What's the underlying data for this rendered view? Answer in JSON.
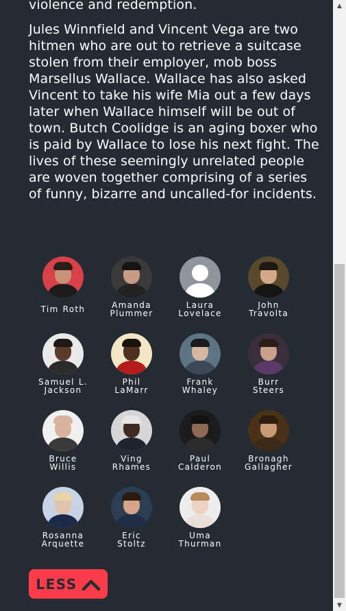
{
  "overview": {
    "tail": "violence and redemption.",
    "text": "Jules Winnfield and Vincent Vega are two hitmen who are out to retrieve a suitcase stolen from their employer, mob boss Marsellus Wallace. Wallace has also asked Vincent to take his wife Mia out a few days later when Wallace himself will be out of town. Butch Coolidge is an aging boxer who is paid by Wallace to lose his next fight. The lives of these seemingly unrelated people are woven together comprising of a series of funny, bizarre and uncalled-for incidents."
  },
  "cast": [
    {
      "first": "Tim Roth",
      "last": "",
      "skin": "#c99178",
      "bg": "#d8404a",
      "hair": "#2a1e18",
      "shirt": "#1b1b1b"
    },
    {
      "first": "Amanda",
      "last": "Plummer",
      "skin": "#c79c84",
      "bg": "#3a3a3a",
      "hair": "#141414",
      "shirt": "#222222"
    },
    {
      "first": "Laura",
      "last": "Lovelace",
      "skin": "",
      "bg": "",
      "hair": "",
      "shirt": "",
      "placeholder": true
    },
    {
      "first": "John",
      "last": "Travolta",
      "skin": "#d4a88a",
      "bg": "#5a4a2c",
      "hair": "#1e1812",
      "shirt": "#141414"
    },
    {
      "first": "Samuel L.",
      "last": "Jackson",
      "skin": "#5b3b2a",
      "bg": "#e9e9e9",
      "hair": "#1f1a18",
      "shirt": "#2b2b2b"
    },
    {
      "first": "Phil",
      "last": "LaMarr",
      "skin": "#4e2f20",
      "bg": "#f2e6c6",
      "hair": "#1a120c",
      "shirt": "#b41c1c"
    },
    {
      "first": "Frank",
      "last": "Whaley",
      "skin": "#d8b7a2",
      "bg": "#5e7384",
      "hair": "#1b1b1b",
      "shirt": "#3c4856"
    },
    {
      "first": "Burr",
      "last": "Steers",
      "skin": "#c9a08c",
      "bg": "#3a2e3a",
      "hair": "#2a1d18",
      "shirt": "#5b3a6a"
    },
    {
      "first": "Bruce",
      "last": "Willis",
      "skin": "#d9b29d",
      "bg": "#f0f0f0",
      "hair": "#d9b29d",
      "shirt": "#3a3a3a"
    },
    {
      "first": "Ving",
      "last": "Rhames",
      "skin": "#3e2a20",
      "bg": "#d6d6d6",
      "hair": "#e6e6e6",
      "shirt": "#1d2430"
    },
    {
      "first": "Paul",
      "last": "Calderon",
      "skin": "#8e6a55",
      "bg": "#1c1c1c",
      "hair": "#111111",
      "shirt": "#2c2c2c"
    },
    {
      "first": "Bronagh",
      "last": "Gallagher",
      "skin": "#c89b74",
      "bg": "#4a3218",
      "hair": "#2e1c0c",
      "shirt": "#3a2a16"
    },
    {
      "first": "Rosanna",
      "last": "Arquette",
      "skin": "#e0c2ae",
      "bg": "#c9d3e6",
      "hair": "#e8d3a6",
      "shirt": "#1b2a4a"
    },
    {
      "first": "Eric",
      "last": "Stoltz",
      "skin": "#d7a38a",
      "bg": "#2b3e52",
      "hair": "#2a1a10",
      "shirt": "#1f2e44"
    },
    {
      "first": "Uma",
      "last": "Thurman",
      "skin": "#ecd2c0",
      "bg": "#ededed",
      "hair": "#b98a5a",
      "shirt": "#e8e0d8"
    }
  ],
  "less_button": {
    "label": "LESS",
    "icon": "chevron-up-icon"
  },
  "colors": {
    "background": "#242b33",
    "accent": "#fc3c4a",
    "text": "#ffffff"
  }
}
